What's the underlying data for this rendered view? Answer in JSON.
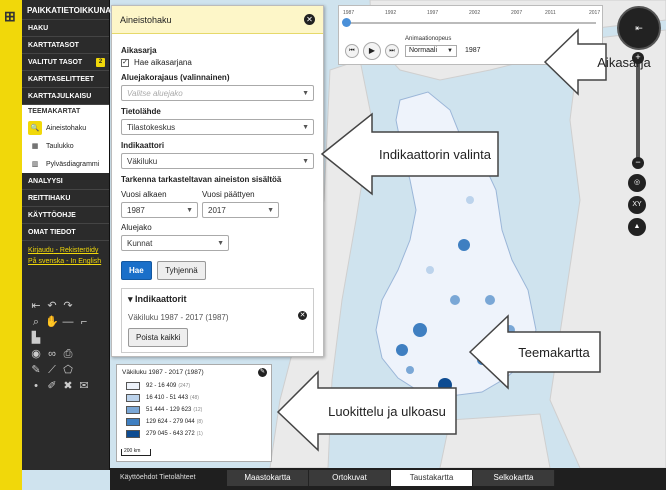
{
  "brand": "PAIKKATIETOIKKUNA",
  "nav": [
    {
      "label": "HAKU"
    },
    {
      "label": "KARTTATASOT"
    },
    {
      "label": "VALITUT TASOT",
      "badge": "2"
    },
    {
      "label": "KARTTASELITTEET"
    },
    {
      "label": "KARTTAJULKAISU"
    }
  ],
  "theme": {
    "title": "TEEMAKARTAT",
    "items": [
      {
        "label": "Aineistohaku",
        "icon": "search-icon",
        "active": true
      },
      {
        "label": "Taulukko",
        "icon": "table-icon"
      },
      {
        "label": "Pylväsdiagrammi",
        "icon": "bar-chart-icon"
      }
    ]
  },
  "nav2": [
    {
      "label": "ANALYYSI"
    },
    {
      "label": "REITTIHAKU"
    },
    {
      "label": "KÄYTTÖOHJE"
    },
    {
      "label": "OMAT TIEDOT"
    }
  ],
  "links": {
    "login": "Kirjaudu",
    "separator": " - ",
    "register": "Rekisteröidy",
    "lang_sv": "På svenska",
    "lang_en": "In English"
  },
  "panel": {
    "title": "Aineistohaku",
    "series_label": "Aikasarja",
    "series_checkbox": "Hae aikasarjana",
    "region_label": "Aluejakorajaus (valinnainen)",
    "region_placeholder": "Valitse aluejako",
    "source_label": "Tietolähde",
    "source_value": "Tilastokeskus",
    "indicator_label": "Indikaattori",
    "indicator_value": "Väkiluku",
    "refine_label": "Tarkenna tarkasteltavan aineiston sisältöä",
    "year_start_label": "Vuosi alkaen",
    "year_start_value": "1987",
    "year_end_label": "Vuosi päättyen",
    "year_end_value": "2017",
    "area_label": "Aluejako",
    "area_value": "Kunnat",
    "search_button": "Hae",
    "clear_button": "Tyhjennä",
    "indicators_title": "Indikaattorit",
    "indicator_entry": "Väkiluku 1987 - 2017 (1987)",
    "remove_all_button": "Poista kaikki"
  },
  "legend": {
    "title": "Väkiluku 1987 - 2017 (1987)",
    "classes": [
      {
        "range": "92 - 16 409",
        "count": "(247)",
        "color": "#eef3fb"
      },
      {
        "range": "16 410 - 51 443",
        "count": "(48)",
        "color": "#bcd3ec"
      },
      {
        "range": "51 444 - 129 623",
        "count": "(12)",
        "color": "#7aa7d6"
      },
      {
        "range": "129 624 - 279 044",
        "count": "(8)",
        "color": "#3f7fc1"
      },
      {
        "range": "279 045 - 643 272",
        "count": "(1)",
        "color": "#0e4c92"
      }
    ],
    "scale": "200 km"
  },
  "timeline": {
    "years": [
      "1987",
      "1992",
      "1997",
      "2002",
      "2007",
      "2011",
      "2017"
    ],
    "animation_label": "Animaationopeus",
    "speed": "Normaali",
    "current_year": "1987"
  },
  "bottom": {
    "terms": "Käyttöehdot",
    "data_sources": "Tietolähteet",
    "tabs": [
      "Maastokartta",
      "Ortokuvat",
      "Taustakartta",
      "Selkokartta"
    ],
    "active_tab": "Taustakartta"
  },
  "callouts": {
    "series": "Aikasarja",
    "indicator": "Indikaattorin valinta",
    "thematic": "Teemakartta",
    "classification": "Luokittelu ja ulkoasu"
  },
  "colors": {
    "accent": "#f1d80a",
    "primary_button": "#1a6fc9",
    "map_water": "#cfe3ee"
  }
}
